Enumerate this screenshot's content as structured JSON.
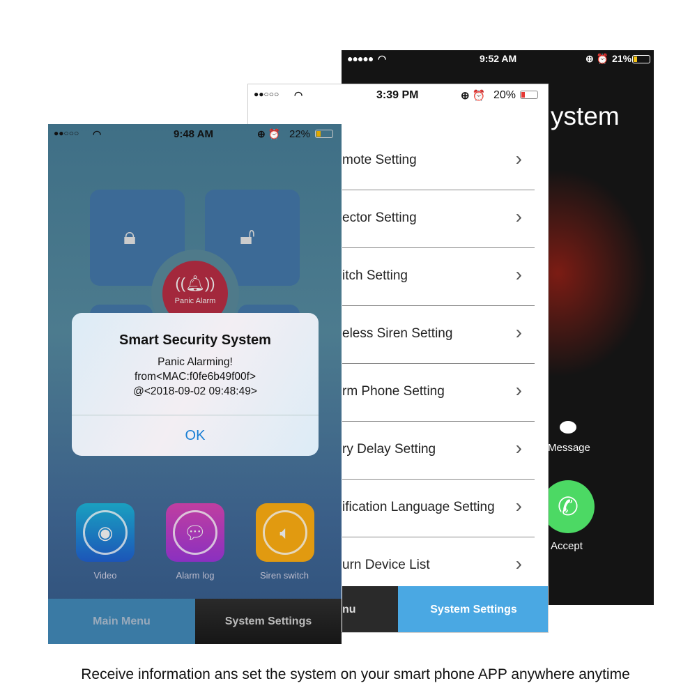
{
  "call_screen": {
    "status": {
      "signal": "●●●●●",
      "time": "9:52 AM",
      "battery": "21%",
      "battery_level": 0.21
    },
    "title": "ystem",
    "message_label": "Message",
    "accept_label": "Accept",
    "accent": "#4cd964"
  },
  "settings_screen": {
    "status": {
      "signal": "●●○○○",
      "time": "3:39 PM",
      "battery": "20%",
      "battery_level": 0.2
    },
    "rows": [
      "mote Setting",
      "ector Setting",
      "itch Setting",
      "eless Siren Setting",
      "rm Phone Setting",
      "ry Delay Setting",
      "ification Language Setting",
      "urn Device List"
    ],
    "tabs": {
      "left": "nu",
      "right": "System Settings"
    },
    "accent": "#4aa8e3"
  },
  "main_screen": {
    "status": {
      "signal": "●●○○○",
      "time": "9:48 AM",
      "battery": "22%",
      "battery_level": 0.22
    },
    "panic_label": "Panic Alarm",
    "dialog": {
      "title": "Smart Security System",
      "line1": "Panic Alarming!",
      "line2": "from<MAC:f0fe6b49f00f>",
      "line3": "@<2018-09-02 09:48:49>",
      "ok": "OK"
    },
    "apps": [
      {
        "label": "Video",
        "icon": "camera-icon"
      },
      {
        "label": "Alarm log",
        "icon": "chat-icon"
      },
      {
        "label": "Siren switch",
        "icon": "speaker-icon"
      }
    ],
    "tabs": {
      "left": "Main Menu",
      "right": "System Settings"
    }
  },
  "caption": "Receive information ans set the system on your smart phone APP anywhere anytime"
}
